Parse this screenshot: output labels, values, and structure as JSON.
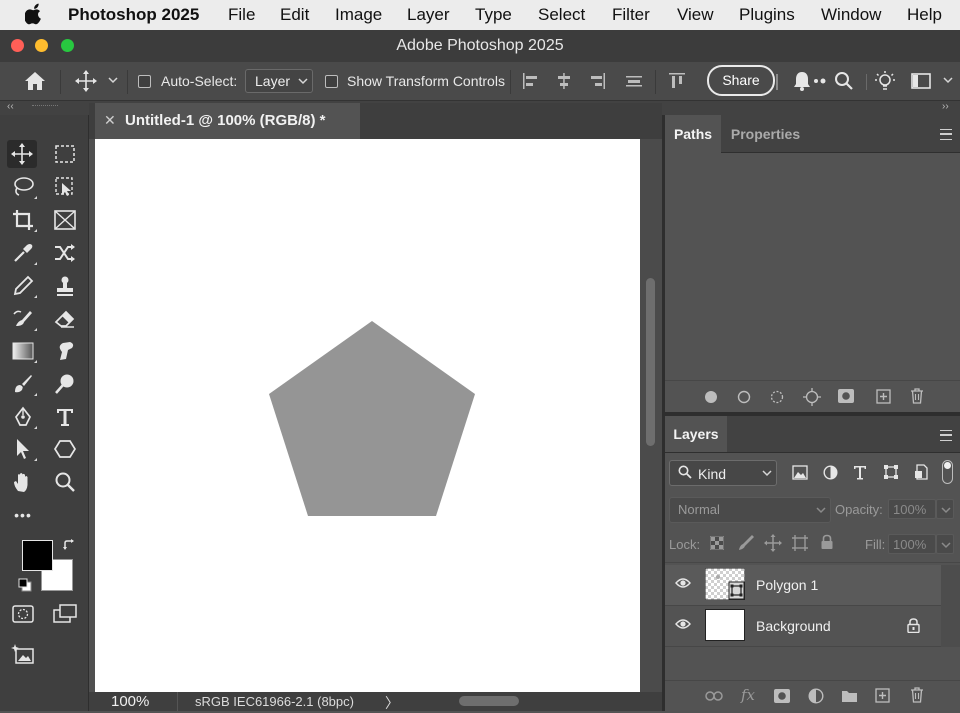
{
  "menubar": {
    "apple_icon": "apple-icon",
    "app_name": "Photoshop 2025",
    "items": [
      "File",
      "Edit",
      "Image",
      "Layer",
      "Type",
      "Select",
      "Filter",
      "View",
      "Plugins",
      "Window",
      "Help"
    ]
  },
  "window": {
    "title": "Adobe Photoshop 2025",
    "traffic_lights": {
      "close": "#ff5f57",
      "minimize": "#febc2e",
      "zoom": "#28c840"
    }
  },
  "options_bar": {
    "auto_select_label": "Auto-Select:",
    "auto_select_checked": false,
    "auto_select_target": "Layer",
    "show_transform_label": "Show Transform Controls",
    "show_transform_checked": false,
    "share_label": "Share"
  },
  "document": {
    "tab_title": "Untitled-1 @ 100% (RGB/8) *",
    "canvas_color": "#ffffff",
    "shape": {
      "type": "pentagon",
      "fill": "#959595"
    }
  },
  "status_bar": {
    "zoom": "100%",
    "color_profile": "sRGB IEC61966-2.1 (8bpc)",
    "arrow": "〉"
  },
  "tools": {
    "foreground_color": "#000000",
    "background_color": "#ffffff",
    "more_label": "•••"
  },
  "paths_panel": {
    "tabs": [
      "Paths",
      "Properties"
    ],
    "active_tab": "Paths"
  },
  "layers_panel": {
    "tab": "Layers",
    "filter_kind": "Kind",
    "blend_mode": "Normal",
    "opacity_label": "Opacity:",
    "opacity_value": "100%",
    "lock_label": "Lock:",
    "fill_label": "Fill:",
    "fill_value": "100%",
    "layers": [
      {
        "name": "Polygon 1",
        "visible": true,
        "locked": false,
        "selected": true
      },
      {
        "name": "Background",
        "visible": true,
        "locked": true,
        "selected": false
      }
    ]
  }
}
